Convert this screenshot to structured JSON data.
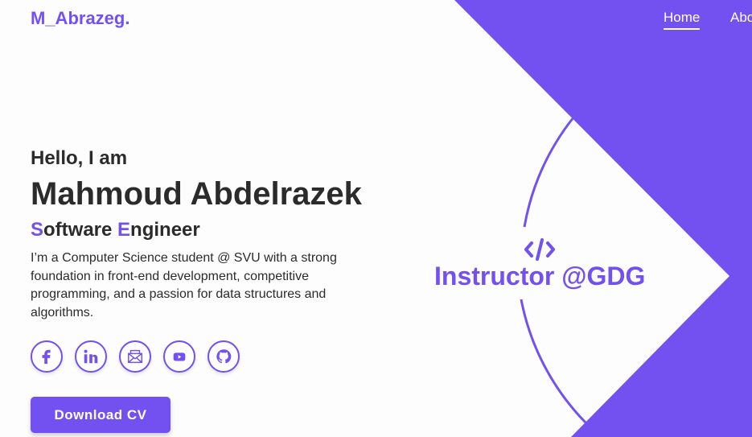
{
  "brand": {
    "logo": "M_Abrazeg."
  },
  "nav": {
    "items": [
      {
        "label": "Home",
        "active": true
      },
      {
        "label": "About",
        "active": false
      }
    ]
  },
  "hero": {
    "greeting": "Hello, I am",
    "name": "Mahmoud Abdelrazek",
    "role": {
      "word1_initial": "S",
      "word1_rest": "oftware ",
      "word2_initial": "E",
      "word2_rest": "ngineer"
    },
    "bio": "I’m a Computer Science student @ SVU with a strong foundation in front-end development, competitive programming, and a passion for data structures and algorithms."
  },
  "socials": [
    {
      "icon": "facebook-icon"
    },
    {
      "icon": "linkedin-icon"
    },
    {
      "icon": "email-icon"
    },
    {
      "icon": "youtube-icon"
    },
    {
      "icon": "github-icon"
    }
  ],
  "cta": {
    "download_label": "Download CV"
  },
  "badge": {
    "icon": "code-icon",
    "label": "Instructor @GDG"
  },
  "colors": {
    "accent": "#7350f0",
    "text": "#2b2b2b",
    "background": "#fdfdfd"
  }
}
